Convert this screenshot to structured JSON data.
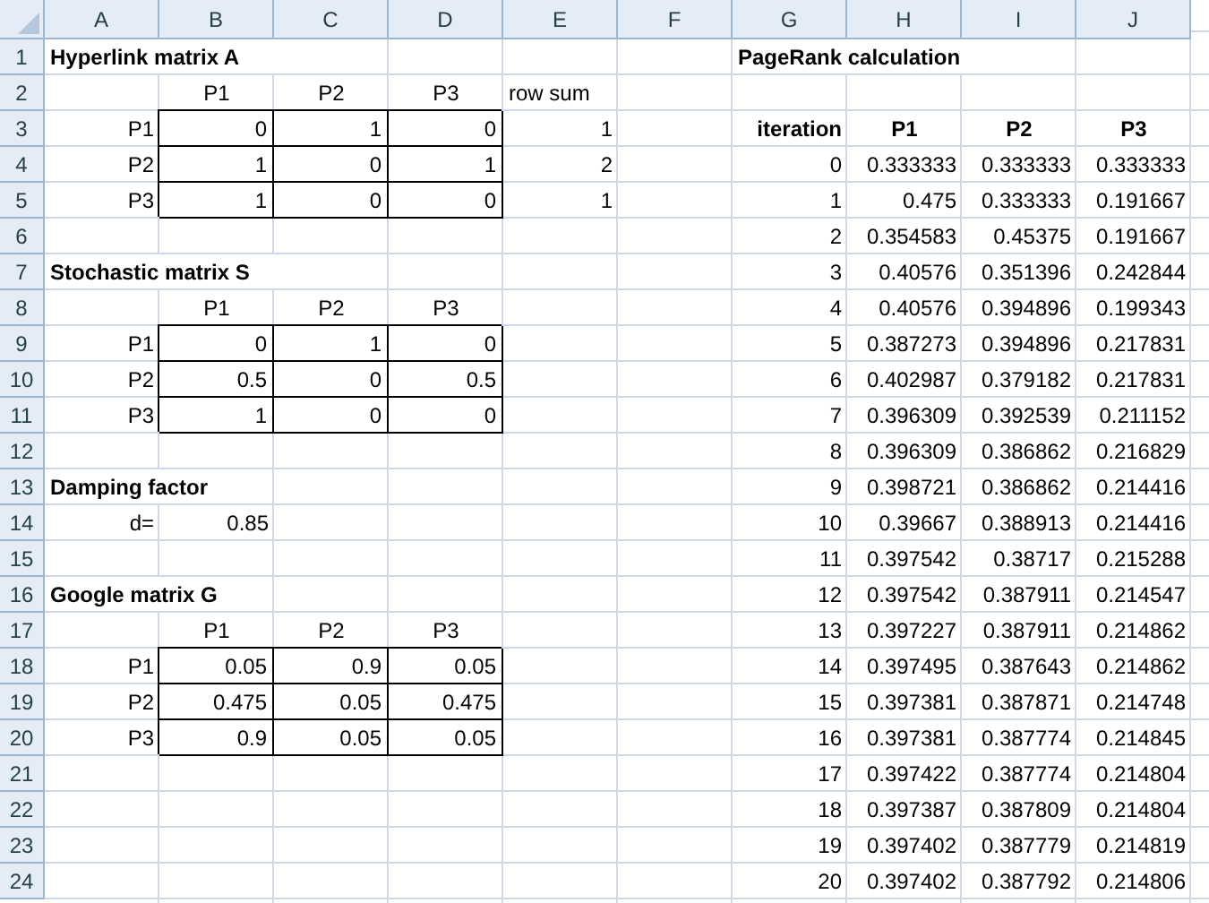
{
  "columns": [
    "A",
    "B",
    "C",
    "D",
    "E",
    "F",
    "G",
    "H",
    "I",
    "J"
  ],
  "rows": [
    {
      "number": "1",
      "cells": [
        {
          "kind": "title",
          "text": "Hyperlink matrix A"
        },
        null,
        null,
        null,
        null,
        null,
        {
          "kind": "title",
          "text": "PageRank calculation"
        },
        null,
        null,
        null
      ]
    },
    {
      "number": "2",
      "cells": [
        null,
        {
          "kind": "heading",
          "text": "P1"
        },
        {
          "kind": "heading",
          "text": "P2"
        },
        {
          "kind": "heading",
          "text": "P3"
        },
        {
          "kind": "label",
          "text": "row sum"
        },
        null,
        null,
        null,
        null,
        null
      ]
    },
    {
      "number": "3",
      "cells": [
        {
          "kind": "row-label",
          "text": "P1"
        },
        {
          "kind": "matrix",
          "text": "0"
        },
        {
          "kind": "matrix",
          "text": "1"
        },
        {
          "kind": "matrix",
          "text": "0"
        },
        {
          "kind": "value",
          "text": "1"
        },
        null,
        {
          "kind": "bold-label",
          "text": "iteration"
        },
        {
          "kind": "bold-heading",
          "text": "P1"
        },
        {
          "kind": "bold-heading",
          "text": "P2"
        },
        {
          "kind": "bold-heading",
          "text": "P3"
        }
      ]
    },
    {
      "number": "4",
      "cells": [
        {
          "kind": "row-label",
          "text": "P2"
        },
        {
          "kind": "matrix",
          "text": "1"
        },
        {
          "kind": "matrix",
          "text": "0"
        },
        {
          "kind": "matrix",
          "text": "1"
        },
        {
          "kind": "value",
          "text": "2"
        },
        null,
        {
          "kind": "value",
          "text": "0"
        },
        {
          "kind": "value",
          "text": "0.333333"
        },
        {
          "kind": "value",
          "text": "0.333333"
        },
        {
          "kind": "value",
          "text": "0.333333"
        }
      ]
    },
    {
      "number": "5",
      "cells": [
        {
          "kind": "row-label",
          "text": "P3"
        },
        {
          "kind": "matrix",
          "text": "1"
        },
        {
          "kind": "matrix",
          "text": "0"
        },
        {
          "kind": "matrix",
          "text": "0"
        },
        {
          "kind": "value",
          "text": "1"
        },
        null,
        {
          "kind": "value",
          "text": "1"
        },
        {
          "kind": "value",
          "text": "0.475"
        },
        {
          "kind": "value",
          "text": "0.333333"
        },
        {
          "kind": "value",
          "text": "0.191667"
        }
      ]
    },
    {
      "number": "6",
      "cells": [
        null,
        null,
        null,
        null,
        null,
        null,
        {
          "kind": "value",
          "text": "2"
        },
        {
          "kind": "value",
          "text": "0.354583"
        },
        {
          "kind": "value",
          "text": "0.45375"
        },
        {
          "kind": "value",
          "text": "0.191667"
        }
      ]
    },
    {
      "number": "7",
      "cells": [
        {
          "kind": "title",
          "text": "Stochastic matrix S"
        },
        null,
        null,
        null,
        null,
        null,
        {
          "kind": "value",
          "text": "3"
        },
        {
          "kind": "value",
          "text": "0.40576"
        },
        {
          "kind": "value",
          "text": "0.351396"
        },
        {
          "kind": "value",
          "text": "0.242844"
        }
      ]
    },
    {
      "number": "8",
      "cells": [
        null,
        {
          "kind": "heading",
          "text": "P1"
        },
        {
          "kind": "heading",
          "text": "P2"
        },
        {
          "kind": "heading",
          "text": "P3"
        },
        null,
        null,
        {
          "kind": "value",
          "text": "4"
        },
        {
          "kind": "value",
          "text": "0.40576"
        },
        {
          "kind": "value",
          "text": "0.394896"
        },
        {
          "kind": "value",
          "text": "0.199343"
        }
      ]
    },
    {
      "number": "9",
      "cells": [
        {
          "kind": "row-label",
          "text": "P1"
        },
        {
          "kind": "matrix",
          "text": "0"
        },
        {
          "kind": "matrix",
          "text": "1"
        },
        {
          "kind": "matrix",
          "text": "0"
        },
        null,
        null,
        {
          "kind": "value",
          "text": "5"
        },
        {
          "kind": "value",
          "text": "0.387273"
        },
        {
          "kind": "value",
          "text": "0.394896"
        },
        {
          "kind": "value",
          "text": "0.217831"
        }
      ]
    },
    {
      "number": "10",
      "cells": [
        {
          "kind": "row-label",
          "text": "P2"
        },
        {
          "kind": "matrix",
          "text": "0.5"
        },
        {
          "kind": "matrix",
          "text": "0"
        },
        {
          "kind": "matrix",
          "text": "0.5"
        },
        null,
        null,
        {
          "kind": "value",
          "text": "6"
        },
        {
          "kind": "value",
          "text": "0.402987"
        },
        {
          "kind": "value",
          "text": "0.379182"
        },
        {
          "kind": "value",
          "text": "0.217831"
        }
      ]
    },
    {
      "number": "11",
      "cells": [
        {
          "kind": "row-label",
          "text": "P3"
        },
        {
          "kind": "matrix",
          "text": "1"
        },
        {
          "kind": "matrix",
          "text": "0"
        },
        {
          "kind": "matrix",
          "text": "0"
        },
        null,
        null,
        {
          "kind": "value",
          "text": "7"
        },
        {
          "kind": "value",
          "text": "0.396309"
        },
        {
          "kind": "value",
          "text": "0.392539"
        },
        {
          "kind": "value",
          "text": "0.211152"
        }
      ]
    },
    {
      "number": "12",
      "cells": [
        null,
        null,
        null,
        null,
        null,
        null,
        {
          "kind": "value",
          "text": "8"
        },
        {
          "kind": "value",
          "text": "0.396309"
        },
        {
          "kind": "value",
          "text": "0.386862"
        },
        {
          "kind": "value",
          "text": "0.216829"
        }
      ]
    },
    {
      "number": "13",
      "cells": [
        {
          "kind": "title",
          "text": "Damping factor"
        },
        null,
        null,
        null,
        null,
        null,
        {
          "kind": "value",
          "text": "9"
        },
        {
          "kind": "value",
          "text": "0.398721"
        },
        {
          "kind": "value",
          "text": "0.386862"
        },
        {
          "kind": "value",
          "text": "0.214416"
        }
      ]
    },
    {
      "number": "14",
      "cells": [
        {
          "kind": "row-label",
          "text": "d="
        },
        {
          "kind": "value",
          "text": "0.85"
        },
        null,
        null,
        null,
        null,
        {
          "kind": "value",
          "text": "10"
        },
        {
          "kind": "value",
          "text": "0.39667"
        },
        {
          "kind": "value",
          "text": "0.388913"
        },
        {
          "kind": "value",
          "text": "0.214416"
        }
      ]
    },
    {
      "number": "15",
      "cells": [
        null,
        null,
        null,
        null,
        null,
        null,
        {
          "kind": "value",
          "text": "11"
        },
        {
          "kind": "value",
          "text": "0.397542"
        },
        {
          "kind": "value",
          "text": "0.38717"
        },
        {
          "kind": "value",
          "text": "0.215288"
        }
      ]
    },
    {
      "number": "16",
      "cells": [
        {
          "kind": "title",
          "text": "Google matrix G"
        },
        null,
        null,
        null,
        null,
        null,
        {
          "kind": "value",
          "text": "12"
        },
        {
          "kind": "value",
          "text": "0.397542"
        },
        {
          "kind": "value",
          "text": "0.387911"
        },
        {
          "kind": "value",
          "text": "0.214547"
        }
      ]
    },
    {
      "number": "17",
      "cells": [
        null,
        {
          "kind": "heading",
          "text": "P1"
        },
        {
          "kind": "heading",
          "text": "P2"
        },
        {
          "kind": "heading",
          "text": "P3"
        },
        null,
        null,
        {
          "kind": "value",
          "text": "13"
        },
        {
          "kind": "value",
          "text": "0.397227"
        },
        {
          "kind": "value",
          "text": "0.387911"
        },
        {
          "kind": "value",
          "text": "0.214862"
        }
      ]
    },
    {
      "number": "18",
      "cells": [
        {
          "kind": "row-label",
          "text": "P1"
        },
        {
          "kind": "matrix",
          "text": "0.05"
        },
        {
          "kind": "matrix",
          "text": "0.9"
        },
        {
          "kind": "matrix",
          "text": "0.05"
        },
        null,
        null,
        {
          "kind": "value",
          "text": "14"
        },
        {
          "kind": "value",
          "text": "0.397495"
        },
        {
          "kind": "value",
          "text": "0.387643"
        },
        {
          "kind": "value",
          "text": "0.214862"
        }
      ]
    },
    {
      "number": "19",
      "cells": [
        {
          "kind": "row-label",
          "text": "P2"
        },
        {
          "kind": "matrix",
          "text": "0.475"
        },
        {
          "kind": "matrix",
          "text": "0.05"
        },
        {
          "kind": "matrix",
          "text": "0.475"
        },
        null,
        null,
        {
          "kind": "value",
          "text": "15"
        },
        {
          "kind": "value",
          "text": "0.397381"
        },
        {
          "kind": "value",
          "text": "0.387871"
        },
        {
          "kind": "value",
          "text": "0.214748"
        }
      ]
    },
    {
      "number": "20",
      "cells": [
        {
          "kind": "row-label",
          "text": "P3"
        },
        {
          "kind": "matrix",
          "text": "0.9"
        },
        {
          "kind": "matrix",
          "text": "0.05"
        },
        {
          "kind": "matrix",
          "text": "0.05"
        },
        null,
        null,
        {
          "kind": "value",
          "text": "16"
        },
        {
          "kind": "value",
          "text": "0.397381"
        },
        {
          "kind": "value",
          "text": "0.387774"
        },
        {
          "kind": "value",
          "text": "0.214845"
        }
      ]
    },
    {
      "number": "21",
      "cells": [
        null,
        null,
        null,
        null,
        null,
        null,
        {
          "kind": "value",
          "text": "17"
        },
        {
          "kind": "value",
          "text": "0.397422"
        },
        {
          "kind": "value",
          "text": "0.387774"
        },
        {
          "kind": "value",
          "text": "0.214804"
        }
      ]
    },
    {
      "number": "22",
      "cells": [
        null,
        null,
        null,
        null,
        null,
        null,
        {
          "kind": "value",
          "text": "18"
        },
        {
          "kind": "value",
          "text": "0.397387"
        },
        {
          "kind": "value",
          "text": "0.387809"
        },
        {
          "kind": "value",
          "text": "0.214804"
        }
      ]
    },
    {
      "number": "23",
      "cells": [
        null,
        null,
        null,
        null,
        null,
        null,
        {
          "kind": "value",
          "text": "19"
        },
        {
          "kind": "value",
          "text": "0.397402"
        },
        {
          "kind": "value",
          "text": "0.387779"
        },
        {
          "kind": "value",
          "text": "0.214819"
        }
      ]
    },
    {
      "number": "24",
      "cells": [
        null,
        null,
        null,
        null,
        null,
        null,
        {
          "kind": "value",
          "text": "20"
        },
        {
          "kind": "value",
          "text": "0.397402"
        },
        {
          "kind": "value",
          "text": "0.387792"
        },
        {
          "kind": "value",
          "text": "0.214806"
        }
      ]
    }
  ]
}
